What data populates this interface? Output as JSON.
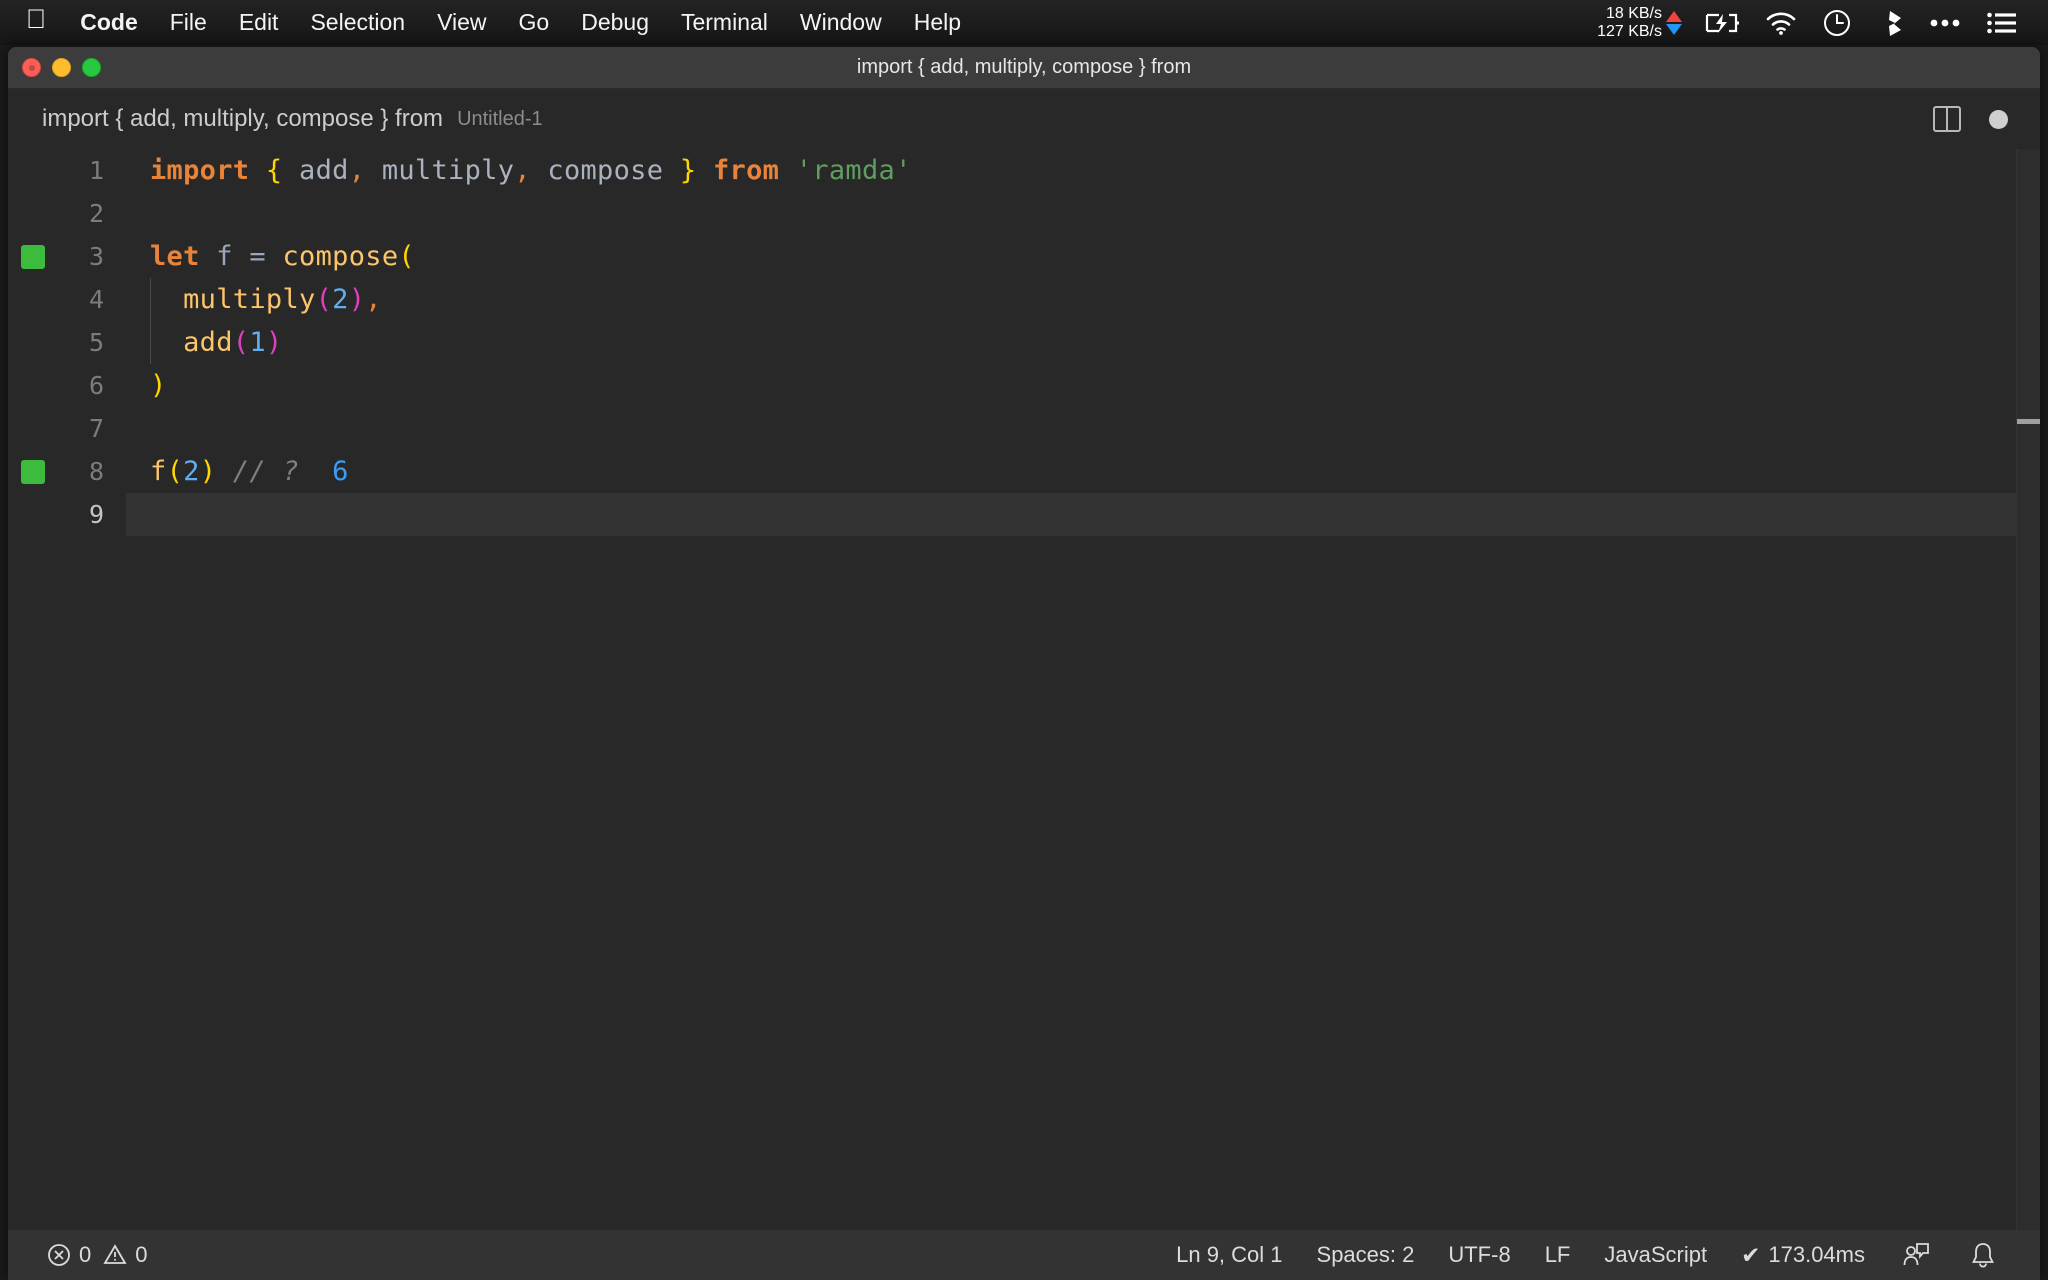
{
  "menubar": {
    "apple_icon": "apple-logo-icon",
    "items": [
      {
        "label": "Code",
        "bold": true
      },
      {
        "label": "File",
        "bold": false
      },
      {
        "label": "Edit",
        "bold": false
      },
      {
        "label": "Selection",
        "bold": false
      },
      {
        "label": "View",
        "bold": false
      },
      {
        "label": "Go",
        "bold": false
      },
      {
        "label": "Debug",
        "bold": false
      },
      {
        "label": "Terminal",
        "bold": false
      },
      {
        "label": "Window",
        "bold": false
      },
      {
        "label": "Help",
        "bold": false
      }
    ],
    "network": {
      "upload": "18 KB/s",
      "download": "127 KB/s",
      "upload_color": "#f0453c",
      "download_color": "#2196f3"
    },
    "status_icons": [
      "battery-charging-icon",
      "wifi-icon",
      "clock-icon",
      "dropbox-icon",
      "ellipsis-icon",
      "list-menu-icon"
    ]
  },
  "window": {
    "title": "import { add, multiply, compose } from",
    "traffic_lights": [
      "close-button",
      "minimize-button",
      "maximize-button"
    ]
  },
  "breadcrumb": {
    "main": "import { add, multiply, compose } from",
    "sub": "Untitled-1",
    "actions": [
      "split-editor-icon",
      "unsaved-dot-icon"
    ]
  },
  "editor": {
    "lines": [
      {
        "num": "1",
        "marker": false,
        "current": false,
        "indent_guide": false,
        "tokens": [
          {
            "t": "import",
            "c": "tk-kw"
          },
          {
            "t": " ",
            "c": "tk-id"
          },
          {
            "t": "{",
            "c": "tk-brc"
          },
          {
            "t": " add",
            "c": "tk-id"
          },
          {
            "t": ",",
            "c": "tk-punc"
          },
          {
            "t": " multiply",
            "c": "tk-id"
          },
          {
            "t": ",",
            "c": "tk-punc"
          },
          {
            "t": " compose ",
            "c": "tk-id"
          },
          {
            "t": "}",
            "c": "tk-brc"
          },
          {
            "t": " ",
            "c": "tk-id"
          },
          {
            "t": "from",
            "c": "tk-kw"
          },
          {
            "t": " ",
            "c": "tk-id"
          },
          {
            "t": "'ramda'",
            "c": "tk-str"
          }
        ]
      },
      {
        "num": "2",
        "marker": false,
        "current": false,
        "indent_guide": false,
        "tokens": []
      },
      {
        "num": "3",
        "marker": true,
        "current": false,
        "indent_guide": false,
        "tokens": [
          {
            "t": "let",
            "c": "tk-kw"
          },
          {
            "t": " ",
            "c": "tk-id"
          },
          {
            "t": "f",
            "c": "tk-var"
          },
          {
            "t": " ",
            "c": "tk-id"
          },
          {
            "t": "=",
            "c": "tk-op"
          },
          {
            "t": " ",
            "c": "tk-id"
          },
          {
            "t": "compose",
            "c": "tk-fn"
          },
          {
            "t": "(",
            "c": "tk-brc"
          }
        ]
      },
      {
        "num": "4",
        "marker": false,
        "current": false,
        "indent_guide": true,
        "tokens": [
          {
            "t": "  ",
            "c": "tk-id"
          },
          {
            "t": "multiply",
            "c": "tk-fn"
          },
          {
            "t": "(",
            "c": "tk-paren-m"
          },
          {
            "t": "2",
            "c": "tk-num"
          },
          {
            "t": ")",
            "c": "tk-paren-m"
          },
          {
            "t": ",",
            "c": "tk-punc"
          }
        ]
      },
      {
        "num": "5",
        "marker": false,
        "current": false,
        "indent_guide": true,
        "tokens": [
          {
            "t": "  ",
            "c": "tk-id"
          },
          {
            "t": "add",
            "c": "tk-fn"
          },
          {
            "t": "(",
            "c": "tk-paren-m"
          },
          {
            "t": "1",
            "c": "tk-num"
          },
          {
            "t": ")",
            "c": "tk-paren-m"
          }
        ]
      },
      {
        "num": "6",
        "marker": false,
        "current": false,
        "indent_guide": false,
        "tokens": [
          {
            "t": ")",
            "c": "tk-brc"
          }
        ]
      },
      {
        "num": "7",
        "marker": false,
        "current": false,
        "indent_guide": false,
        "tokens": []
      },
      {
        "num": "8",
        "marker": true,
        "current": false,
        "indent_guide": false,
        "tokens": [
          {
            "t": "f",
            "c": "tk-fn"
          },
          {
            "t": "(",
            "c": "tk-brc"
          },
          {
            "t": "2",
            "c": "tk-num"
          },
          {
            "t": ")",
            "c": "tk-brc"
          },
          {
            "t": " ",
            "c": "tk-id"
          },
          {
            "t": "// ?",
            "c": "tk-com"
          },
          {
            "t": "  ",
            "c": "tk-id"
          },
          {
            "t": "6",
            "c": "tk-val"
          }
        ]
      },
      {
        "num": "9",
        "marker": false,
        "current": true,
        "indent_guide": false,
        "tokens": []
      }
    ]
  },
  "statusbar": {
    "errors": "0",
    "warnings": "0",
    "cursor": "Ln 9, Col 1",
    "indent": "Spaces: 2",
    "encoding": "UTF-8",
    "eol": "LF",
    "language": "JavaScript",
    "runtime": "173.04ms",
    "runtime_check": "✔",
    "right_icons": [
      "feedback-icon",
      "bell-icon"
    ]
  }
}
